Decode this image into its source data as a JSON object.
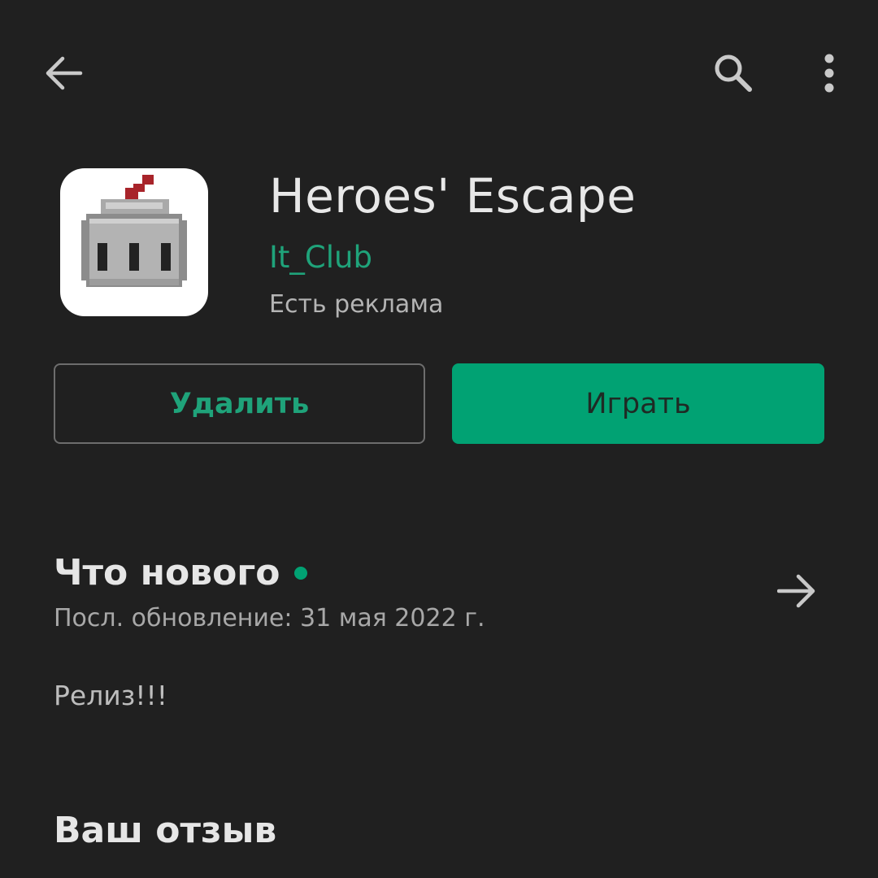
{
  "toolbar": {
    "back_icon": "arrow-back-icon",
    "search_icon": "search-icon",
    "more_icon": "more-vert-icon"
  },
  "app": {
    "icon": "knight-helmet-app-icon",
    "title": "Heroes' Escape",
    "developer": "It_Club",
    "ads_notice": "Есть реклама"
  },
  "actions": {
    "uninstall_label": "Удалить",
    "play_label": "Играть"
  },
  "whats_new": {
    "title": "Что нового",
    "last_update": "Посл. обновление: 31 мая 2022 г.",
    "notes": "Релиз!!!",
    "arrow_icon": "arrow-forward-icon"
  },
  "review": {
    "title": "Ваш отзыв"
  },
  "colors": {
    "background": "#202020",
    "accent_green": "#01a273",
    "developer_text": "#1fa37a"
  }
}
